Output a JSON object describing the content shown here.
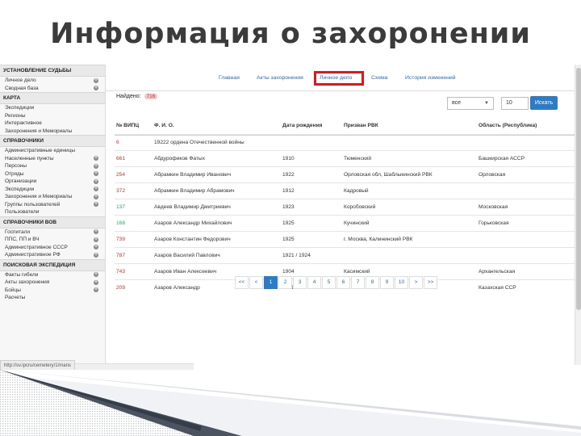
{
  "slide": {
    "title": "Информация о захоронении"
  },
  "sidebar": {
    "groups": [
      {
        "title": "Установление судьбы",
        "items": [
          {
            "label": "Личное дело",
            "plus": true
          },
          {
            "label": "Сводная база",
            "plus": true
          }
        ]
      },
      {
        "title": "Карта",
        "items": [
          {
            "label": "Экспедиции",
            "plus": false
          },
          {
            "label": "Регионы",
            "plus": false
          },
          {
            "label": "Интерактивное",
            "plus": false
          },
          {
            "label": "Захоронения и Мемориалы",
            "plus": false
          }
        ]
      },
      {
        "title": "Справочники",
        "items": [
          {
            "label": "Административные единицы",
            "plus": false
          },
          {
            "label": "Населенные пункты",
            "plus": true
          },
          {
            "label": "Персоны",
            "plus": true
          },
          {
            "label": "Отряды",
            "plus": true
          },
          {
            "label": "Организации",
            "plus": true
          },
          {
            "label": "Экспедиции",
            "plus": true
          },
          {
            "label": "Захоронения и Мемориалы",
            "plus": true
          },
          {
            "label": "Группы пользователей",
            "plus": true
          },
          {
            "label": "Пользователи",
            "plus": false
          }
        ]
      },
      {
        "title": "Справочники ВОВ",
        "items": [
          {
            "label": "Госпитали",
            "plus": true
          },
          {
            "label": "ППС, ПП и ВЧ",
            "plus": true
          },
          {
            "label": "Административное СССР",
            "plus": true
          },
          {
            "label": "Административное РФ",
            "plus": true
          }
        ]
      },
      {
        "title": "Поисковая экспедиция",
        "items": [
          {
            "label": "Факты гибели",
            "plus": true
          },
          {
            "label": "Акты захоронения",
            "plus": true
          },
          {
            "label": "Бойцы",
            "plus": true
          },
          {
            "label": "Расчеты",
            "plus": false
          }
        ]
      }
    ]
  },
  "tabs": [
    "Главная",
    "Акты захоронения",
    "Личное дело",
    "Схема",
    "История изменений"
  ],
  "found": {
    "label": "Найдено:",
    "count": "716"
  },
  "controls": {
    "select_value": "все",
    "page_size": "10",
    "search_button": "Искать"
  },
  "table": {
    "headers": [
      "№ ВИПЦ",
      "Ф. И. О.",
      "Дата рождения",
      "Призван РВК",
      "Область (Республика)"
    ],
    "rows": [
      [
        "6",
        "19222 ордена Отечественной войны",
        "",
        "",
        ""
      ],
      [
        "661",
        "Абдурофиков Фатых",
        "1910",
        "Тюменский",
        "Башкирская АССР"
      ],
      [
        "254",
        "Абрамкин Владимир Иванович",
        "1922",
        "Орловская обл, Шаблыкинский РВК",
        "Орловская"
      ],
      [
        "372",
        "Абрамкин Владимир Абрамович",
        "1912",
        "Кадровый",
        ""
      ],
      [
        "137",
        "Авдеев Владимир Дмитриевич",
        "1923",
        "Коробовский",
        "Московская"
      ],
      [
        "168",
        "Азаров Александр Михайлович",
        "1925",
        "Кучинский",
        "Горьковская"
      ],
      [
        "739",
        "Азаров Константин Федорович",
        "1925",
        "г. Москва, Калининский РВК",
        ""
      ],
      [
        "787",
        "Азаров Василий Павлович",
        "1921 / 1924",
        "",
        ""
      ],
      [
        "743",
        "Азаров Иван Алексеевич",
        "1904",
        "Касимский",
        "Архангельская"
      ],
      [
        "209",
        "Азаров Александр",
        "1901",
        "",
        "Казахская ССР"
      ]
    ],
    "row_num_colors": [
      "red",
      "red",
      "red",
      "red",
      "green",
      "green",
      "red",
      "red",
      "red",
      "red"
    ]
  },
  "pagination": [
    "<<",
    "<",
    "1",
    "2",
    "3",
    "4",
    "5",
    "6",
    "7",
    "8",
    "9",
    "10",
    ">",
    ">>"
  ],
  "pagination_active": "1",
  "status_url": "http://sv.ipcru/cemetery/1/mans"
}
